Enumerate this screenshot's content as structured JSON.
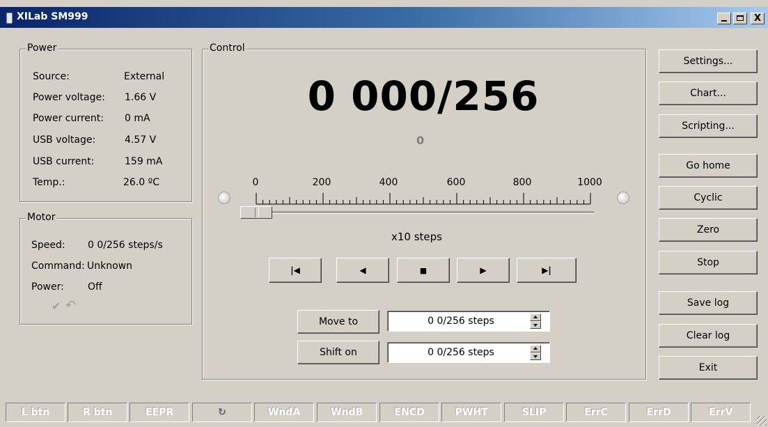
{
  "window": {
    "title": "XILab SM999",
    "min": "_",
    "close": "X"
  },
  "power": {
    "title": "Power",
    "rows": [
      {
        "label": "Source:",
        "value": "External"
      },
      {
        "label": "Power voltage:",
        "value": "1.66 V"
      },
      {
        "label": "Power current:",
        "value": "0 mA"
      },
      {
        "label": "USB voltage:",
        "value": "4.57 V"
      },
      {
        "label": "USB current:",
        "value": "159 mA"
      },
      {
        "label": "Temp.:",
        "value": "26.0 ºC"
      }
    ]
  },
  "motor": {
    "title": "Motor",
    "speed_label": "Speed:",
    "speed_value": "0 0/256 steps/s",
    "command_label": "Command:",
    "command_value": "Unknown",
    "power_label": "Power:",
    "power_value": "Off",
    "check_icon": "✔",
    "undo_icon": "↶"
  },
  "control": {
    "title": "Control",
    "position": "0 000/256",
    "sub_value": "0",
    "scale_labels": [
      "0",
      "200",
      "400",
      "600",
      "800",
      "1000"
    ],
    "scale_unit": "x10  steps",
    "slider_fraction": 0.0,
    "transport": {
      "first": "|◀",
      "prev": "◀",
      "stop": "■",
      "next": "▶",
      "last": "▶|"
    },
    "move_to_label": "Move to",
    "move_to_value": "0 0/256 steps",
    "shift_on_label": "Shift on",
    "shift_on_value": "0 0/256 steps"
  },
  "side_buttons": {
    "settings": "Settings...",
    "chart": "Chart...",
    "scripting": "Scripting...",
    "go_home": "Go home",
    "cyclic": "Cyclic",
    "zero": "Zero",
    "stop": "Stop",
    "save_log": "Save log",
    "clear_log": "Clear log",
    "exit": "Exit"
  },
  "status_bar": [
    "L btn",
    "R btn",
    "EEPR",
    "↻",
    "WndA",
    "WndB",
    "ENCD",
    "PWHT",
    "SLIP",
    "ErrC",
    "ErrD",
    "ErrV"
  ]
}
